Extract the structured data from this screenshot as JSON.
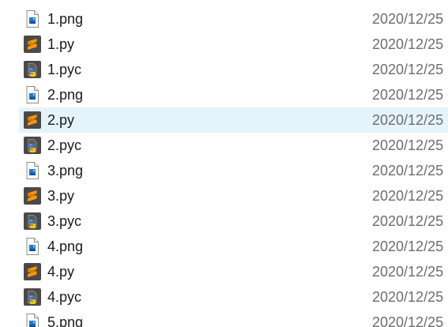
{
  "files": [
    {
      "name": "1.png",
      "type": "png-image-icon",
      "date": "2020/12/25"
    },
    {
      "name": "1.py",
      "type": "sublime-text-icon",
      "date": "2020/12/25"
    },
    {
      "name": "1.pyc",
      "type": "python-compiled-icon",
      "date": "2020/12/25"
    },
    {
      "name": "2.png",
      "type": "png-image-icon",
      "date": "2020/12/25"
    },
    {
      "name": "2.py",
      "type": "sublime-text-icon",
      "date": "2020/12/25",
      "selected": true
    },
    {
      "name": "2.pyc",
      "type": "python-compiled-icon",
      "date": "2020/12/25"
    },
    {
      "name": "3.png",
      "type": "png-image-icon",
      "date": "2020/12/25"
    },
    {
      "name": "3.py",
      "type": "sublime-text-icon",
      "date": "2020/12/25"
    },
    {
      "name": "3.pyc",
      "type": "python-compiled-icon",
      "date": "2020/12/25"
    },
    {
      "name": "4.png",
      "type": "png-image-icon",
      "date": "2020/12/25"
    },
    {
      "name": "4.py",
      "type": "sublime-text-icon",
      "date": "2020/12/25"
    },
    {
      "name": "4.pyc",
      "type": "python-compiled-icon",
      "date": "2020/12/25"
    },
    {
      "name": "5.png",
      "type": "png-image-icon",
      "date": "2020/12/25"
    }
  ],
  "colors": {
    "selection": "#e5f3fd",
    "text": "#1a1a1a",
    "date_text": "#6d6d6d",
    "sublime_bg": "#4a4a4a",
    "sublime_accent": "#ff9800",
    "image_blue": "#1f7ad8"
  }
}
